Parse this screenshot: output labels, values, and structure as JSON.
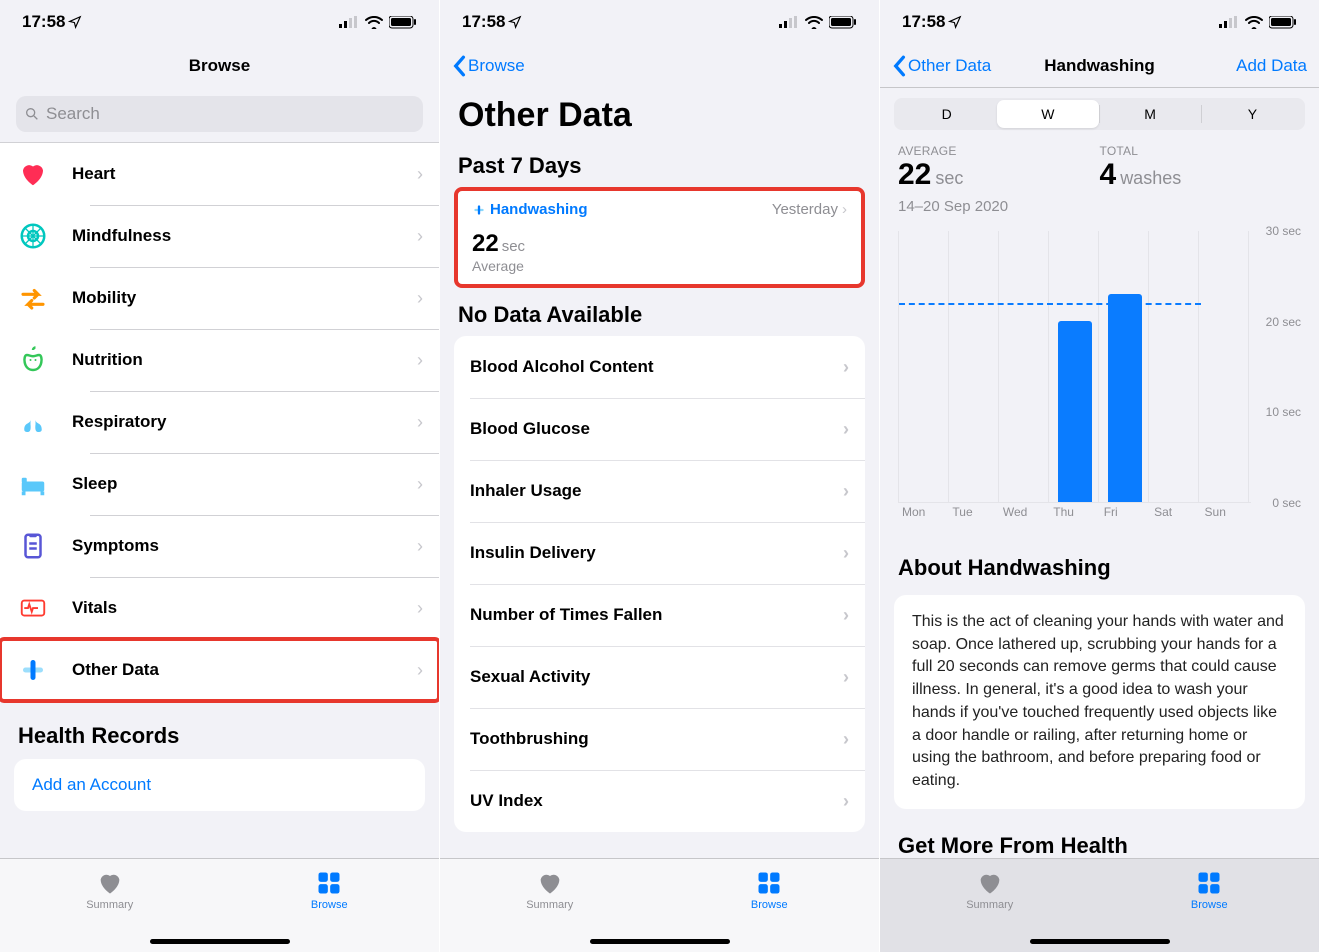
{
  "status": {
    "time": "17:58"
  },
  "screen1": {
    "title": "Browse",
    "search_placeholder": "Search",
    "categories": [
      {
        "label": "Heart"
      },
      {
        "label": "Mindfulness"
      },
      {
        "label": "Mobility"
      },
      {
        "label": "Nutrition"
      },
      {
        "label": "Respiratory"
      },
      {
        "label": "Sleep"
      },
      {
        "label": "Symptoms"
      },
      {
        "label": "Vitals"
      },
      {
        "label": "Other Data"
      }
    ],
    "records_header": "Health Records",
    "add_account": "Add an Account"
  },
  "screen2": {
    "back": "Browse",
    "title": "Other Data",
    "past7": "Past 7 Days",
    "hw": {
      "name": "Handwashing",
      "when": "Yesterday",
      "value": "22",
      "unit": "sec",
      "sub": "Average"
    },
    "nodata_header": "No Data Available",
    "items": [
      "Blood Alcohol Content",
      "Blood Glucose",
      "Inhaler Usage",
      "Insulin Delivery",
      "Number of Times Fallen",
      "Sexual Activity",
      "Toothbrushing",
      "UV Index"
    ]
  },
  "screen3": {
    "back": "Other Data",
    "title": "Handwashing",
    "add": "Add Data",
    "segments": [
      "D",
      "W",
      "M",
      "Y"
    ],
    "avg_label": "AVERAGE",
    "avg_value": "22",
    "avg_unit": "sec",
    "total_label": "TOTAL",
    "total_value": "4",
    "total_unit": "washes",
    "range": "14–20 Sep 2020",
    "yticks": [
      "30 sec",
      "20 sec",
      "10 sec",
      "0 sec"
    ],
    "xlabels": [
      "Mon",
      "Tue",
      "Wed",
      "Thu",
      "Fri",
      "Sat",
      "Sun"
    ],
    "about_header": "About Handwashing",
    "about_body": "This is the act of cleaning your hands with water and soap. Once lathered up, scrubbing your hands for a full 20 seconds can remove germs that could cause illness. In general, it's a good idea to wash your hands if you've touched frequently used objects like a door handle or railing, after returning home or using the bathroom, and before preparing food or eating.",
    "more_header": "Get More From Health"
  },
  "tabs": {
    "summary": "Summary",
    "browse": "Browse"
  },
  "chart_data": {
    "type": "bar",
    "categories": [
      "Mon",
      "Tue",
      "Wed",
      "Thu",
      "Fri",
      "Sat",
      "Sun"
    ],
    "values": [
      null,
      null,
      null,
      20,
      23,
      null,
      null
    ],
    "average": 22,
    "title": "Handwashing",
    "xlabel": "",
    "ylabel": "sec",
    "ylim": [
      0,
      30
    ],
    "yticks": [
      0,
      10,
      20,
      30
    ]
  }
}
